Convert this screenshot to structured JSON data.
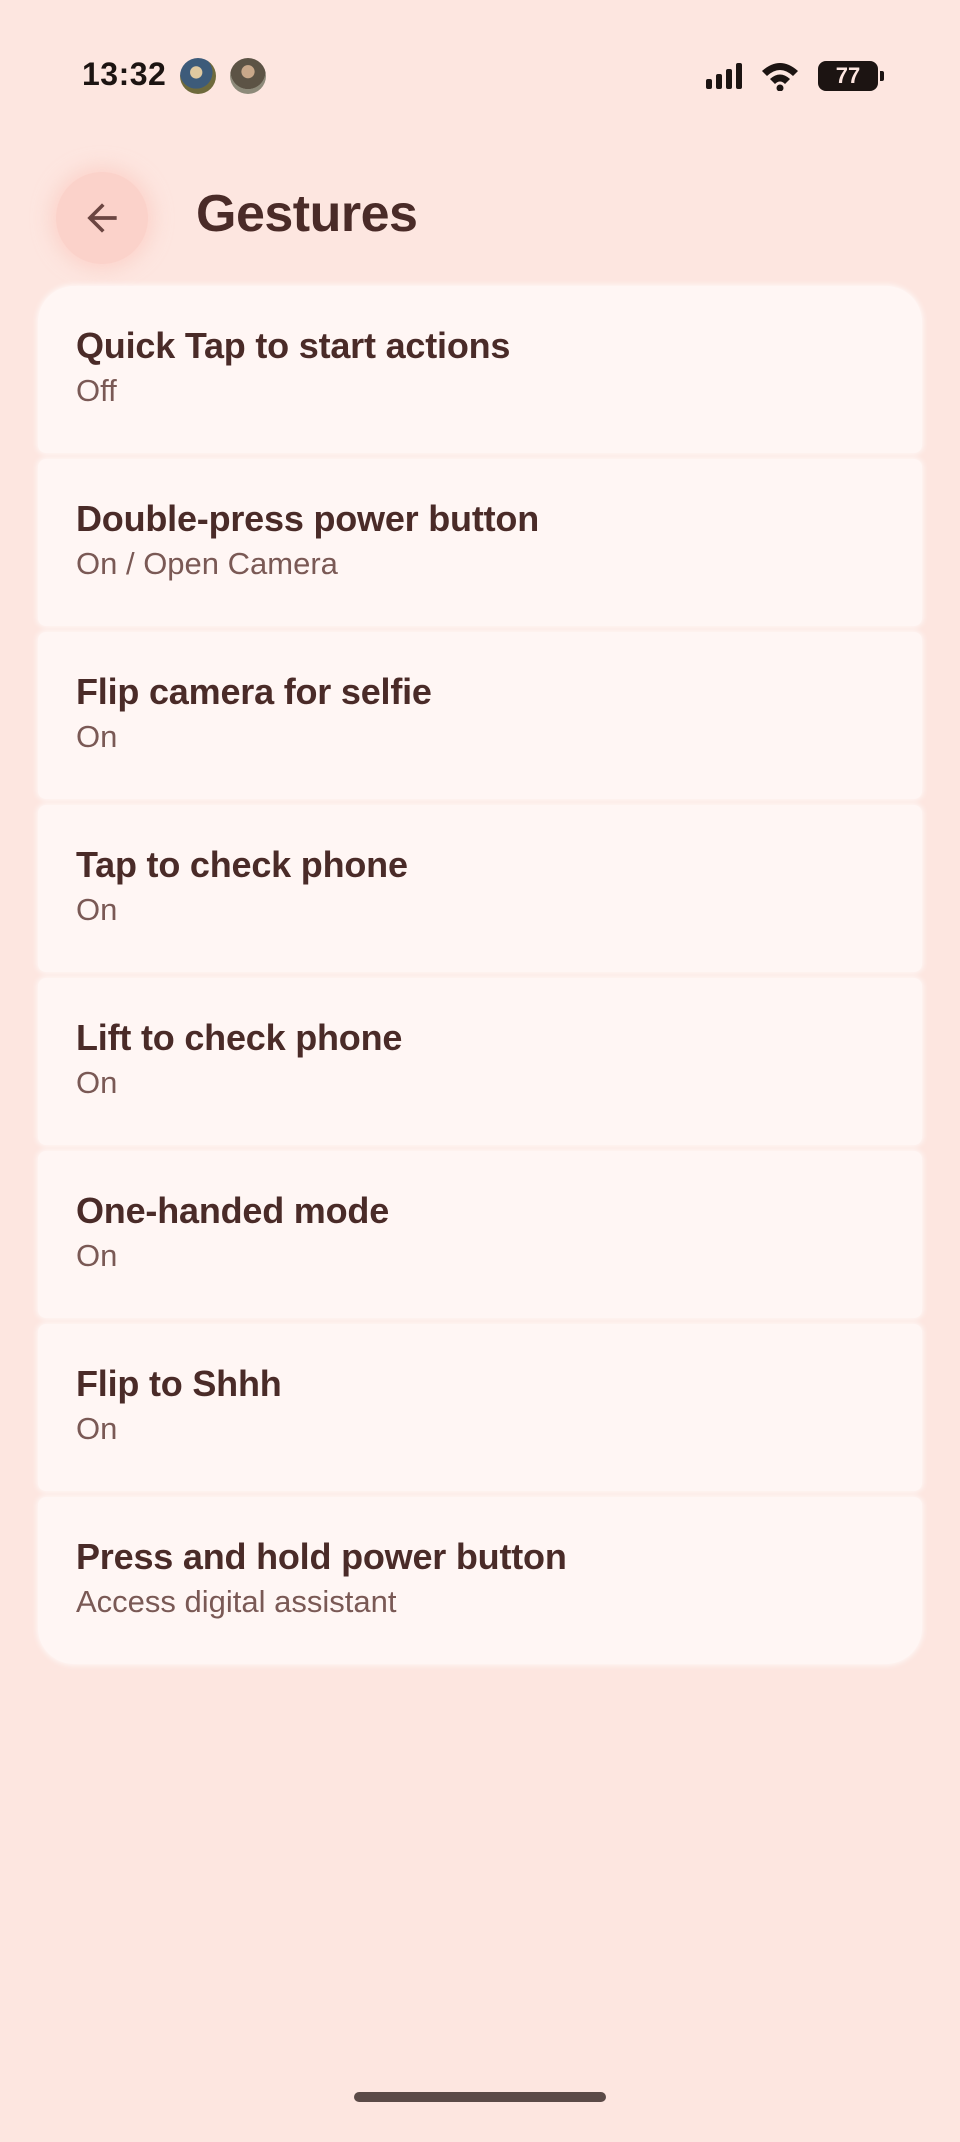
{
  "status_bar": {
    "time": "13:32",
    "battery": "77",
    "icons": [
      "avatar-1",
      "avatar-2",
      "signal-icon",
      "wifi-icon",
      "battery-icon"
    ]
  },
  "app_bar": {
    "back_icon": "arrow-left-icon",
    "title": "Gestures"
  },
  "items": [
    {
      "title": "Quick Tap to start actions",
      "summary": "Off"
    },
    {
      "title": "Double-press power button",
      "summary": "On / Open Camera"
    },
    {
      "title": "Flip camera for selfie",
      "summary": "On"
    },
    {
      "title": "Tap to check phone",
      "summary": "On"
    },
    {
      "title": "Lift to check phone",
      "summary": "On"
    },
    {
      "title": "One-handed mode",
      "summary": "On"
    },
    {
      "title": "Flip to Shhh",
      "summary": "On"
    },
    {
      "title": "Press and hold power button",
      "summary": "Access digital assistant"
    }
  ],
  "colors": {
    "background": "#fde6e0",
    "card": "#fff6f4",
    "title_text": "#4a2b28",
    "summary_text": "#7a5955",
    "back_button_bg": "#fbd2ca"
  }
}
